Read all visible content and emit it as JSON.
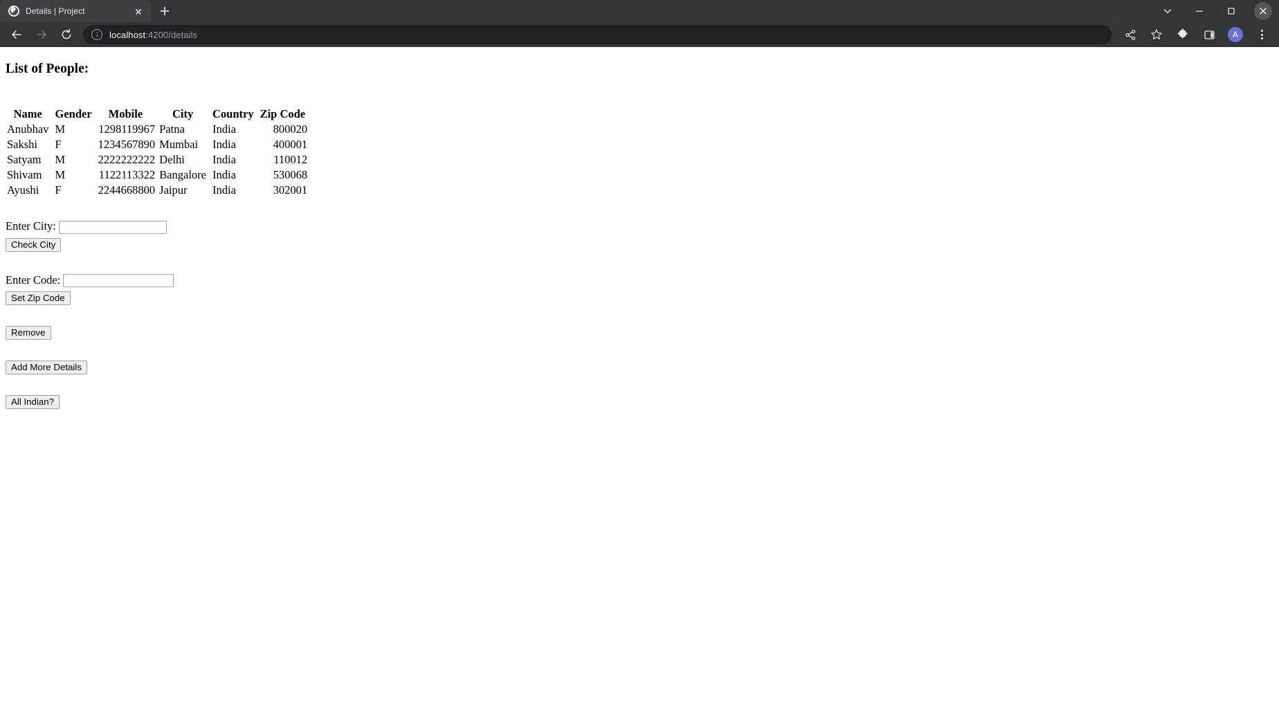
{
  "browser": {
    "tab": {
      "title": "Details | Project",
      "favicon": "globe-icon",
      "close": "×"
    },
    "new_tab_tooltip": "New tab",
    "window_controls": {
      "tab_search": "chevron-down-icon",
      "minimize": "minimize-icon",
      "maximize": "maximize-icon",
      "close": "close-icon"
    },
    "nav": {
      "back": "back-arrow-icon",
      "forward": "forward-arrow-icon",
      "reload": "reload-icon"
    },
    "omnibox": {
      "site_info": "info-circle-icon",
      "host": "localhost",
      "path": ":4200/details",
      "full_url": "localhost:4200/details"
    },
    "actions": {
      "share": "share-icon",
      "bookmark": "star-icon",
      "extensions": "puzzle-icon",
      "side_panel": "side-panel-icon",
      "profile_initial": "A",
      "menu": "three-dot-menu-icon"
    },
    "colors": {
      "chrome_bg": "#323639",
      "tab_active_bg": "#3c4043",
      "omnibox_bg": "#202124",
      "avatar_bg": "#6873d6",
      "text_light": "#e8eaed",
      "text_dim": "#9aa0a6"
    }
  },
  "page": {
    "heading": "List of People:",
    "table": {
      "columns": [
        "Name",
        "Gender",
        "Mobile",
        "City",
        "Country",
        "Zip Code"
      ],
      "rows": [
        {
          "name": "Anubhav",
          "gender": "M",
          "mobile": "1298119967",
          "city": "Patna",
          "country": "India",
          "zip": "800020"
        },
        {
          "name": "Sakshi",
          "gender": "F",
          "mobile": "1234567890",
          "city": "Mumbai",
          "country": "India",
          "zip": "400001"
        },
        {
          "name": "Satyam",
          "gender": "M",
          "mobile": "2222222222",
          "city": "Delhi",
          "country": "India",
          "zip": "110012"
        },
        {
          "name": "Shivam",
          "gender": "M",
          "mobile": "1122113322",
          "city": "Bangalore",
          "country": "India",
          "zip": "530068"
        },
        {
          "name": "Ayushi",
          "gender": "F",
          "mobile": "2244668800",
          "city": "Jaipur",
          "country": "India",
          "zip": "302001"
        }
      ]
    },
    "city_form": {
      "label": "Enter City:",
      "input_value": "",
      "input_placeholder": "",
      "button": "Check City"
    },
    "code_form": {
      "label": "Enter Code:",
      "input_value": "",
      "input_placeholder": "",
      "button": "Set Zip Code"
    },
    "buttons": {
      "remove": "Remove",
      "add_more_details": "Add More Details",
      "all_indian": "All Indian?"
    }
  }
}
